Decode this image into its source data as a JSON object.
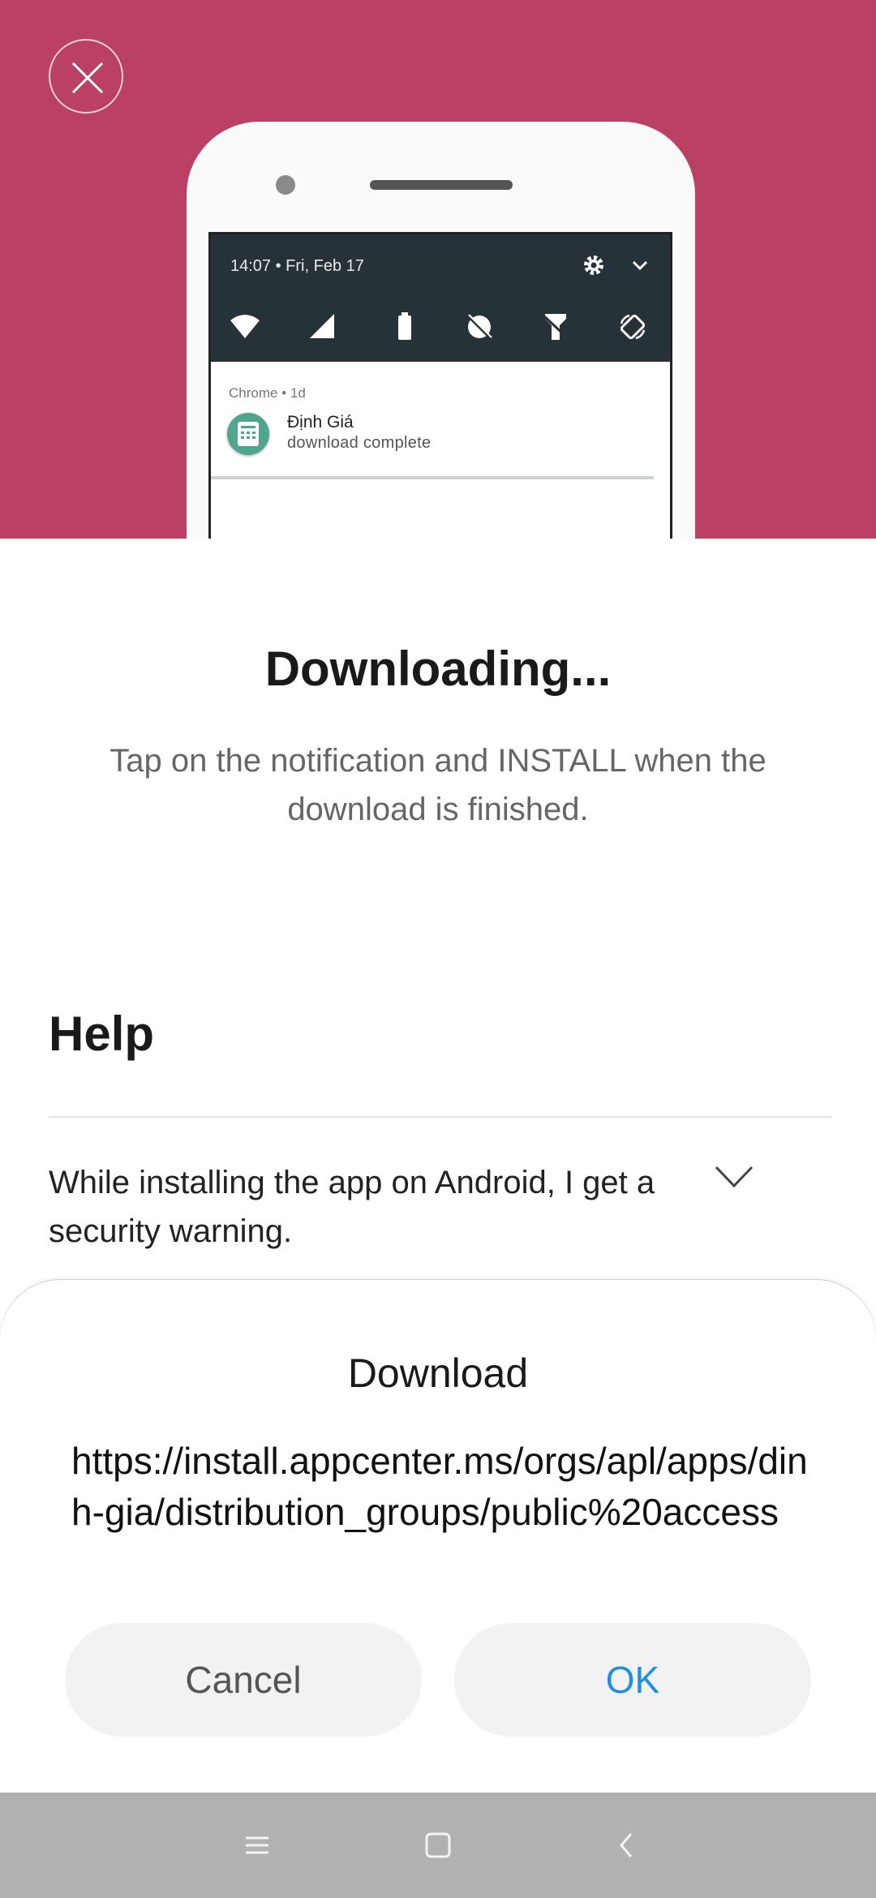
{
  "colors": {
    "hero_bg": "#ba4163",
    "accent_ok": "#1e8fe1",
    "nav_bg": "#b1b1b1"
  },
  "icons": {
    "close": "close-icon",
    "settings": "gear-icon",
    "expand": "chevron-down-icon",
    "quick_settings": [
      "wifi-icon",
      "signal-icon",
      "battery-icon",
      "dnd-icon",
      "flashlight-icon",
      "auto-rotate-icon"
    ],
    "faq_expand": "chevron-down-icon",
    "nav": [
      "menu-icon",
      "home-icon",
      "back-icon"
    ]
  },
  "illustration": {
    "status_time": "14:07 • Fri, Feb 17",
    "notification": {
      "source": "Chrome • 1d",
      "title": "Định Giá",
      "text": "download complete"
    }
  },
  "main": {
    "heading": "Downloading...",
    "subtext": "Tap on the notification and INSTALL when the download is finished."
  },
  "help": {
    "title": "Help",
    "faqs": [
      {
        "question": "While installing the app on Android, I get a security warning."
      }
    ]
  },
  "dialog": {
    "title": "Download",
    "url": "https://install.appcenter.ms/orgs/apl/apps/dinh-gia/distribution_groups/public%20access",
    "cancel_label": "Cancel",
    "ok_label": "OK"
  }
}
